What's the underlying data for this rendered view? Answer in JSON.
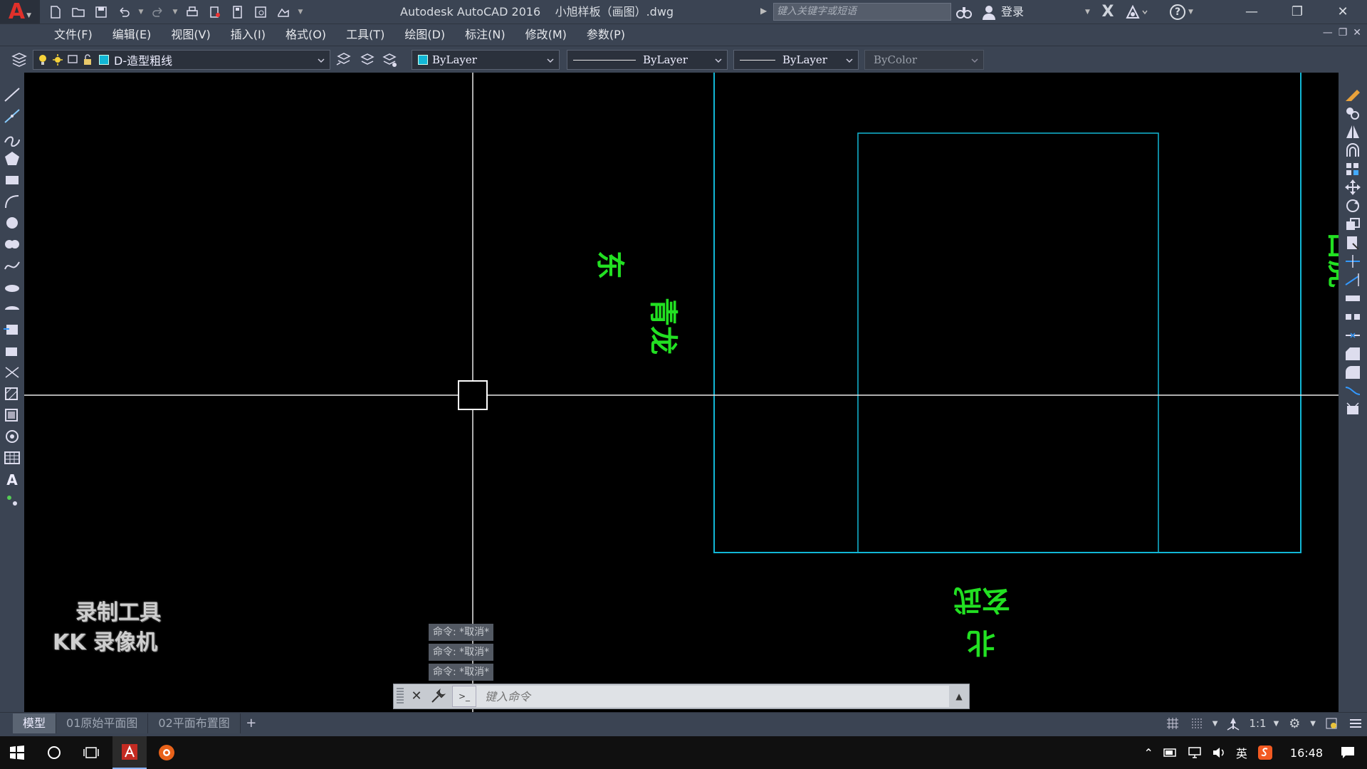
{
  "window": {
    "title": "Autodesk AutoCAD 2016    小旭样板（画图）.dwg",
    "search_placeholder": "键入关键字或短语",
    "login_label": "登录",
    "app_icon": "autocad-a-logo"
  },
  "menubar": {
    "items": [
      "文件(F)",
      "编辑(E)",
      "视图(V)",
      "插入(I)",
      "格式(O)",
      "工具(T)",
      "绘图(D)",
      "标注(N)",
      "修改(M)",
      "参数(P)"
    ]
  },
  "properties": {
    "layer_name": "D-造型粗线",
    "layer_color": "#12b7d6",
    "color_value": "ByLayer",
    "linetype_value": "ByLayer",
    "lineweight_value": "ByLayer",
    "plotstyle_value": "ByColor"
  },
  "drawing": {
    "labels": {
      "dong": "东",
      "qinglong": "青龙",
      "baihu": "白虎",
      "xuanwu": "玄武",
      "bei": "北"
    },
    "text_color": "#22e022",
    "rect_color": "#12b7d6"
  },
  "watermark": {
    "line1": "录制工具",
    "line2": "KK 录像机"
  },
  "command": {
    "history": [
      "命令: *取消*",
      "命令: *取消*",
      "命令: *取消*"
    ],
    "placeholder": "键入命令"
  },
  "layout_tabs": [
    "模型",
    "01原始平面图",
    "02平面布置图"
  ],
  "status": {
    "scale": "1:1"
  },
  "taskbar": {
    "time": "16:48",
    "ime": "英"
  }
}
